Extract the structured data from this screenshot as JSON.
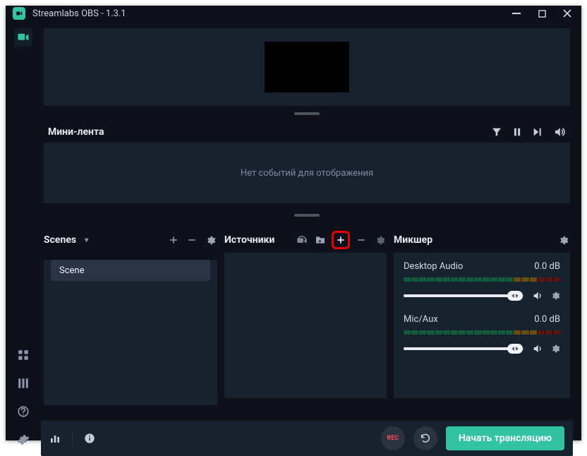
{
  "window": {
    "title": "Streamlabs OBS - 1.3.1"
  },
  "feed": {
    "title": "Мини-лента",
    "empty": "Нет событий для отображения"
  },
  "scenes": {
    "title": "Scenes",
    "items": [
      "Scene"
    ]
  },
  "sources": {
    "title": "Источники"
  },
  "mixer": {
    "title": "Микшер",
    "items": [
      {
        "name": "Desktop Audio",
        "db": "0.0 dB"
      },
      {
        "name": "Mic/Aux",
        "db": "0.0 dB"
      }
    ]
  },
  "footer": {
    "rec": "REC",
    "go_live": "Начать трансляцию"
  }
}
